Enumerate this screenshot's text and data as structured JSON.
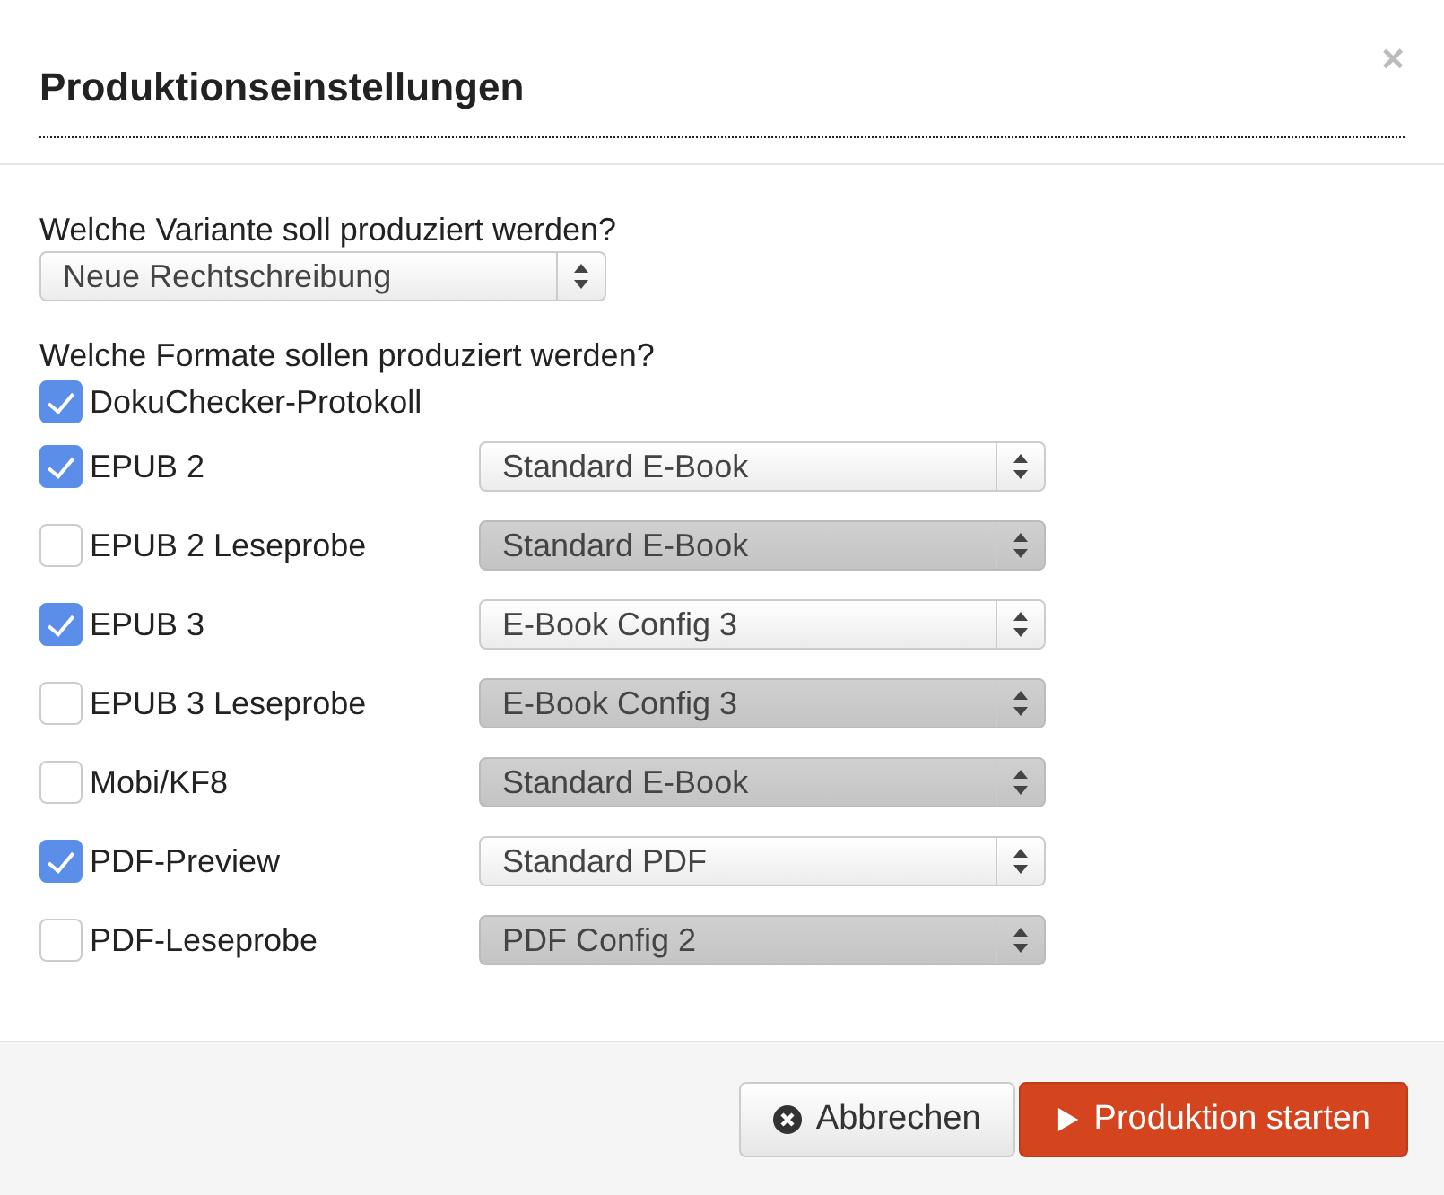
{
  "dialog": {
    "title": "Produktionseinstellungen",
    "close": "×"
  },
  "variant": {
    "label": "Welche Variante soll produziert werden?",
    "value": "Neue Rechtschreibung"
  },
  "formats_label": "Welche Formate sollen produziert werden?",
  "formats": [
    {
      "label": "DokuChecker-Protokoll",
      "checked": true
    },
    {
      "label": "EPUB 2",
      "checked": true,
      "config": {
        "value": "Standard E-Book",
        "disabled": false
      }
    },
    {
      "label": "EPUB 2 Leseprobe",
      "checked": false,
      "config": {
        "value": "Standard E-Book",
        "disabled": true
      }
    },
    {
      "label": "EPUB 3",
      "checked": true,
      "config": {
        "value": "E-Book Config 3",
        "disabled": false
      }
    },
    {
      "label": "EPUB 3 Leseprobe",
      "checked": false,
      "config": {
        "value": "E-Book Config 3",
        "disabled": true
      }
    },
    {
      "label": "Mobi/KF8",
      "checked": false,
      "config": {
        "value": "Standard E-Book",
        "disabled": true
      }
    },
    {
      "label": "PDF-Preview",
      "checked": true,
      "config": {
        "value": "Standard PDF",
        "disabled": false
      }
    },
    {
      "label": "PDF-Leseprobe",
      "checked": false,
      "config": {
        "value": "PDF Config 2",
        "disabled": true
      }
    }
  ],
  "buttons": [
    {
      "kind": "cancel",
      "label": "Abbrechen"
    },
    {
      "kind": "primary",
      "label": "Produktion starten"
    }
  ]
}
